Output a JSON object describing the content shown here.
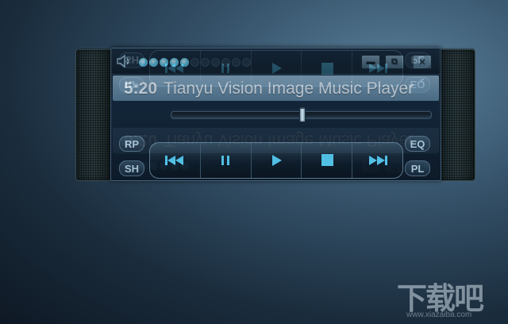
{
  "player": {
    "time": "5:20",
    "title": "Tianyu Vision Image Music Player",
    "volume": {
      "level": 5,
      "max": 11
    },
    "seek_progress": 0.5,
    "window_buttons": {
      "minimize": "▬",
      "restore": "⧉",
      "close": "✕"
    },
    "left_buttons": {
      "repeat": "RP",
      "shuffle": "SH"
    },
    "right_buttons": {
      "equalizer": "EQ",
      "playlist": "PL"
    },
    "transport_icons": [
      "previous-icon",
      "pause-icon",
      "play-icon",
      "stop-icon",
      "next-icon"
    ],
    "accent_color": "#55c8ee"
  },
  "watermark": {
    "text": "下载吧",
    "sub": "www.xiazaiba.com"
  }
}
